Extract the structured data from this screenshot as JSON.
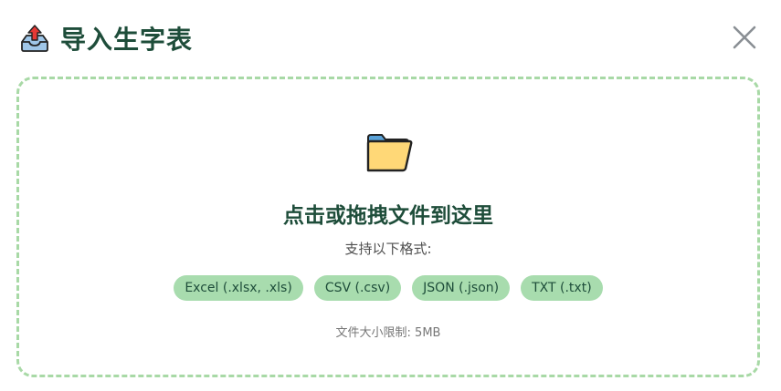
{
  "dialog": {
    "title": "导入生字表",
    "header_icon": "inbox-upload-icon",
    "close_icon": "close-icon"
  },
  "dropzone": {
    "icon": "folder-icon",
    "title": "点击或拖拽文件到这里",
    "formats_label": "支持以下格式:",
    "formats": [
      "Excel (.xlsx, .xls)",
      "CSV (.csv)",
      "JSON (.json)",
      "TXT (.txt)"
    ],
    "size_limit": "文件大小限制: 5MB"
  },
  "colors": {
    "title": "#1e4d3a",
    "dashed_border": "#a8d9a6",
    "badge_bg": "#a8dcae"
  }
}
